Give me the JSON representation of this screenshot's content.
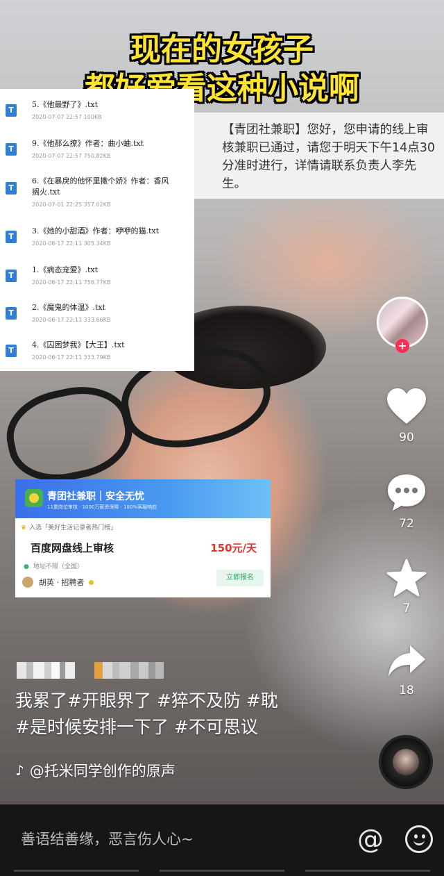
{
  "overlay": {
    "title_line1": "现在的女孩子",
    "title_line2": "都好爱看这种小说啊"
  },
  "files": [
    {
      "name": "5.《他最野了》.txt",
      "meta": "2020-07-07  22:57  100KB"
    },
    {
      "name": "9.《他那么撩》作者：曲小蛐.txt",
      "meta": "2020-07-07  22:57  750.82KB"
    },
    {
      "name": "6.《在暴戾的他怀里撒个娇》作者：香风",
      "name2": "搁火.txt",
      "meta": "2020-07-01  22:25  357.02KB"
    },
    {
      "name": "3.《她的小甜酒》作者：咿咿的猫.txt",
      "meta": "2020-06-17  22:11  305.34KB"
    },
    {
      "name": "1.《病态宠爱》.txt",
      "meta": "2020-06-17  22:11  756.77KB"
    },
    {
      "name": "2.《魔鬼的体温》.txt",
      "meta": "2020-06-17  22:11  333.66KB"
    },
    {
      "name": "4.《囚困梦我》【大王】.txt",
      "meta": "2020-06-17  22:11  333.79KB"
    }
  ],
  "sms": {
    "text": "【青团社兼职】您好，您申请的线上审核兼职已通过，请您于明天下午14点30分准时进行，详情请联系负责人李先生。"
  },
  "job_card": {
    "brand": "青团社兼职｜安全无忧",
    "subline": "11重岗位审核 · 1000万薪资保障 · 100%客服响应",
    "tag": "入选「美好生活记录者热门榜」",
    "title": "百度网盘线上审核",
    "salary": "150元/天",
    "location": "地址不限（全国）",
    "recruiter": "胡英 · 招聘者",
    "apply_label": "立即报名"
  },
  "actions": {
    "like_count": "90",
    "comment_count": "72",
    "favorite_count": "7",
    "share_count": "18"
  },
  "caption": {
    "line1": "我累了#开眼界了 #猝不及防 #耽",
    "line2": "#是时候安排一下了 #不可思议"
  },
  "music": {
    "label": "@托米同学创作的原声"
  },
  "comment_bar": {
    "placeholder": "善语结善缘，恶言伤人心~",
    "at_symbol": "@"
  },
  "colors": {
    "title_yellow": "#ffe533",
    "follow_red": "#fe2c55",
    "salary_red": "#e5322d",
    "apply_green": "#2aa564"
  }
}
